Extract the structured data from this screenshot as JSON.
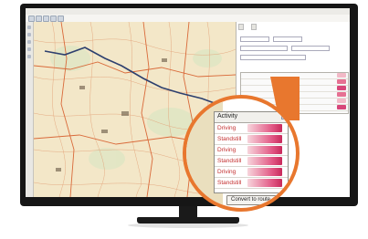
{
  "activity_list": {
    "header": "Activity",
    "rows": [
      {
        "label": "Driving"
      },
      {
        "label": "Standstill"
      },
      {
        "label": "Driving"
      },
      {
        "label": "Standstill"
      },
      {
        "label": "Driving"
      },
      {
        "label": "Standstill"
      }
    ]
  },
  "convert_button": {
    "label": "Convert to route",
    "chevron": "▾"
  },
  "scroll_arrow": "▲",
  "colors": {
    "callout": "#e8772e",
    "row_text": "#c42f2f",
    "bar_light": "#f7d5dc",
    "bar_dark": "#c82a5b",
    "route": "#2d3f6e",
    "map_base": "#f3e7c8",
    "roads": "#d96a3a"
  },
  "icons": [
    "scroll-up-icon",
    "chevron-down-icon"
  ]
}
